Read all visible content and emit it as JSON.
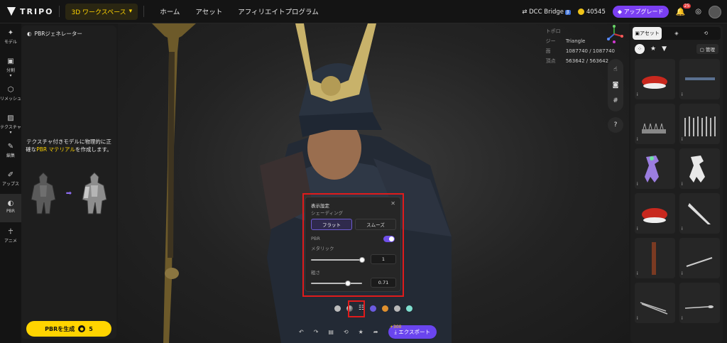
{
  "topbar": {
    "brand": "TRIPO",
    "workspace_label": "3D ワークスペース",
    "nav": [
      "ホーム",
      "アセット",
      "アフィリエイトプログラム"
    ],
    "dcc_bridge": "DCC Bridge",
    "credits": "40545",
    "upgrade_label": "アップグレード",
    "notifications": "25"
  },
  "leftnav": {
    "items": [
      {
        "label": "モデル",
        "icon": "sparkle-icon"
      },
      {
        "label": "分割",
        "icon": "cube-icon"
      },
      {
        "label": "リメッシュ",
        "icon": "mesh-icon"
      },
      {
        "label": "テクスチャ",
        "icon": "texture-icon"
      },
      {
        "label": "編集",
        "icon": "brush-icon"
      },
      {
        "label": "アップス",
        "icon": "edit-icon"
      },
      {
        "label": "PBR",
        "icon": "half-circle-icon"
      },
      {
        "label": "アニメ",
        "icon": "figure-icon"
      }
    ]
  },
  "leftpanel": {
    "title": "PBRジェネレーター",
    "desc_pre": "テクスチャ付きモデルに物理的に正確な",
    "desc_highlight": "PBR マテリアル",
    "desc_post": "を作成します。",
    "generate_label": "PBRを生成",
    "generate_cost": "5"
  },
  "viewport": {
    "stats": [
      {
        "key": "トポロジー",
        "value": "Triangle"
      },
      {
        "key": "面",
        "value": "1087740 / 1087740"
      },
      {
        "key": "頂点",
        "value": "563642 / 563642"
      }
    ],
    "tools": [
      "hand-icon",
      "camera-icon",
      "grid-icon",
      "help-icon"
    ]
  },
  "display_settings": {
    "title": "表示設定",
    "shading_label": "シェーディング",
    "flat": "フラット",
    "smooth": "スムーズ",
    "pbr_label": "PBR",
    "metallic_label": "メタリック",
    "metallic_value": "1",
    "roughness_label": "粗さ",
    "roughness_value": "0.71"
  },
  "bottom": {
    "plus_credits": "+300",
    "export_label": "エクスポート",
    "material_balls": [
      "#bcbcbc",
      "#9a9a9a",
      "#6b5be0",
      "#e0902e",
      "#b9b9b9",
      "#7fe0d0"
    ]
  },
  "rightpanel": {
    "tabs": [
      "アセット",
      "",
      ""
    ],
    "manage_label": "管理",
    "info": "i"
  },
  "colors": {
    "accent": "#ffd400",
    "purple": "#6a45ef",
    "highlight": "#e01b1b"
  }
}
